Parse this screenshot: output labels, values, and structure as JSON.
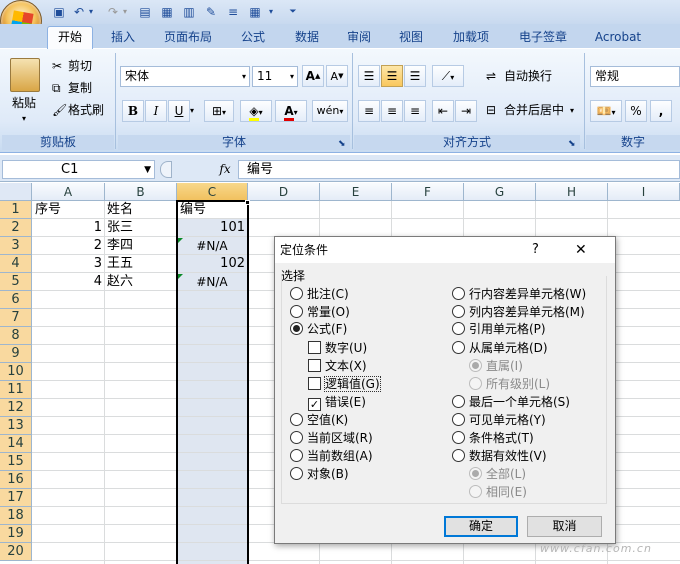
{
  "ribbon": {
    "tabs": [
      "开始",
      "插入",
      "页面布局",
      "公式",
      "数据",
      "审阅",
      "视图",
      "加载项",
      "电子签章",
      "Acrobat"
    ],
    "clipboard": {
      "paste": "粘贴",
      "cut": "剪切",
      "copy": "复制",
      "format_painter": "格式刷",
      "group": "剪贴板"
    },
    "font": {
      "name": "宋体",
      "size": "11",
      "group": "字体",
      "grow": "A",
      "shrink": "A",
      "bold": "B",
      "italic": "I",
      "underline": "U",
      "phonetic": "wén"
    },
    "alignment": {
      "wrap": "自动换行",
      "merge": "合并后居中",
      "group": "对齐方式"
    },
    "number": {
      "format": "常规",
      "group": "数字",
      "percent": "%",
      "comma": ","
    }
  },
  "formula_bar": {
    "cell_ref": "C1",
    "fx": "fx",
    "value": "编号"
  },
  "sheet": {
    "columns": [
      "A",
      "B",
      "C",
      "D",
      "E",
      "F",
      "G",
      "H",
      "I"
    ],
    "rows": [
      "1",
      "2",
      "3",
      "4",
      "5",
      "6",
      "7",
      "8",
      "9",
      "10",
      "11",
      "12",
      "13",
      "14",
      "15",
      "16",
      "17",
      "18",
      "19",
      "20"
    ],
    "cells": {
      "A1": "序号",
      "B1": "姓名",
      "C1": "编号",
      "A2": "1",
      "B2": "张三",
      "C2": "101",
      "A3": "2",
      "B3": "李四",
      "C3": "#N/A",
      "A4": "3",
      "B4": "王五",
      "C4": "102",
      "A5": "4",
      "B5": "赵六",
      "C5": "#N/A"
    }
  },
  "dialog": {
    "title": "定位条件",
    "help": "?",
    "close": "✕",
    "section": "选择",
    "left_options": [
      {
        "label": "批注(C)",
        "checked": false
      },
      {
        "label": "常量(O)",
        "checked": false
      },
      {
        "label": "公式(F)",
        "checked": true
      }
    ],
    "formula_checks": [
      {
        "label": "数字(U)",
        "checked": false
      },
      {
        "label": "文本(X)",
        "checked": false
      },
      {
        "label": "逻辑值(G)",
        "checked": false
      },
      {
        "label": "错误(E)",
        "checked": true
      }
    ],
    "left_options2": [
      {
        "label": "空值(K)",
        "checked": false
      },
      {
        "label": "当前区域(R)",
        "checked": false
      },
      {
        "label": "当前数组(A)",
        "checked": false
      },
      {
        "label": "对象(B)",
        "checked": false
      }
    ],
    "right_options": [
      {
        "label": "行内容差异单元格(W)",
        "checked": false
      },
      {
        "label": "列内容差异单元格(M)",
        "checked": false
      },
      {
        "label": "引用单元格(P)",
        "checked": false
      },
      {
        "label": "从属单元格(D)",
        "checked": false
      }
    ],
    "dependents_sub": [
      {
        "label": "直属(I)",
        "checked": true
      },
      {
        "label": "所有级别(L)",
        "checked": false
      }
    ],
    "right_options2": [
      {
        "label": "最后一个单元格(S)",
        "checked": false
      },
      {
        "label": "可见单元格(Y)",
        "checked": false
      },
      {
        "label": "条件格式(T)",
        "checked": false
      },
      {
        "label": "数据有效性(V)",
        "checked": false
      }
    ],
    "validation_sub": [
      {
        "label": "全部(L)",
        "checked": true
      },
      {
        "label": "相同(E)",
        "checked": false
      }
    ],
    "ok": "确定",
    "cancel": "取消"
  },
  "watermark": "www.cfan.com.cn"
}
